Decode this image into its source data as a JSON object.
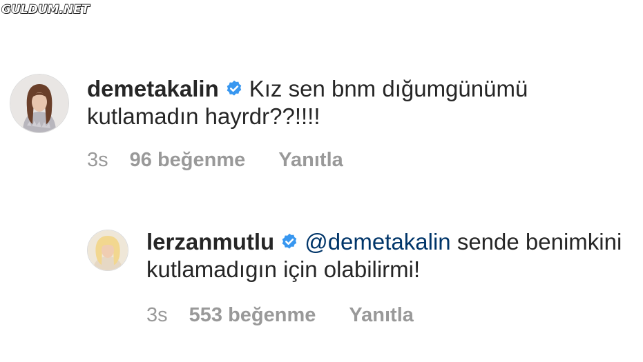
{
  "watermark": "GULDUM.NET",
  "colors": {
    "text": "#262626",
    "muted": "#999999",
    "mention": "#003569",
    "verified": "#3897f0"
  },
  "comments": [
    {
      "username": "demetakalin",
      "verified": true,
      "verified_icon": "verified-badge-icon",
      "mention": "",
      "text": "Kız sen bnm dığumgünümü kutlamadın hayrdr??!!!!",
      "time": "3s",
      "likes": "96 beğenme",
      "reply": "Yanıtla"
    },
    {
      "username": "lerzanmutlu",
      "verified": true,
      "verified_icon": "verified-badge-icon",
      "mention": "@demetakalin",
      "text": "sende benimkini kutlamadıgın için olabilirmi!",
      "time": "3s",
      "likes": "553 beğenme",
      "reply": "Yanıtla"
    }
  ]
}
